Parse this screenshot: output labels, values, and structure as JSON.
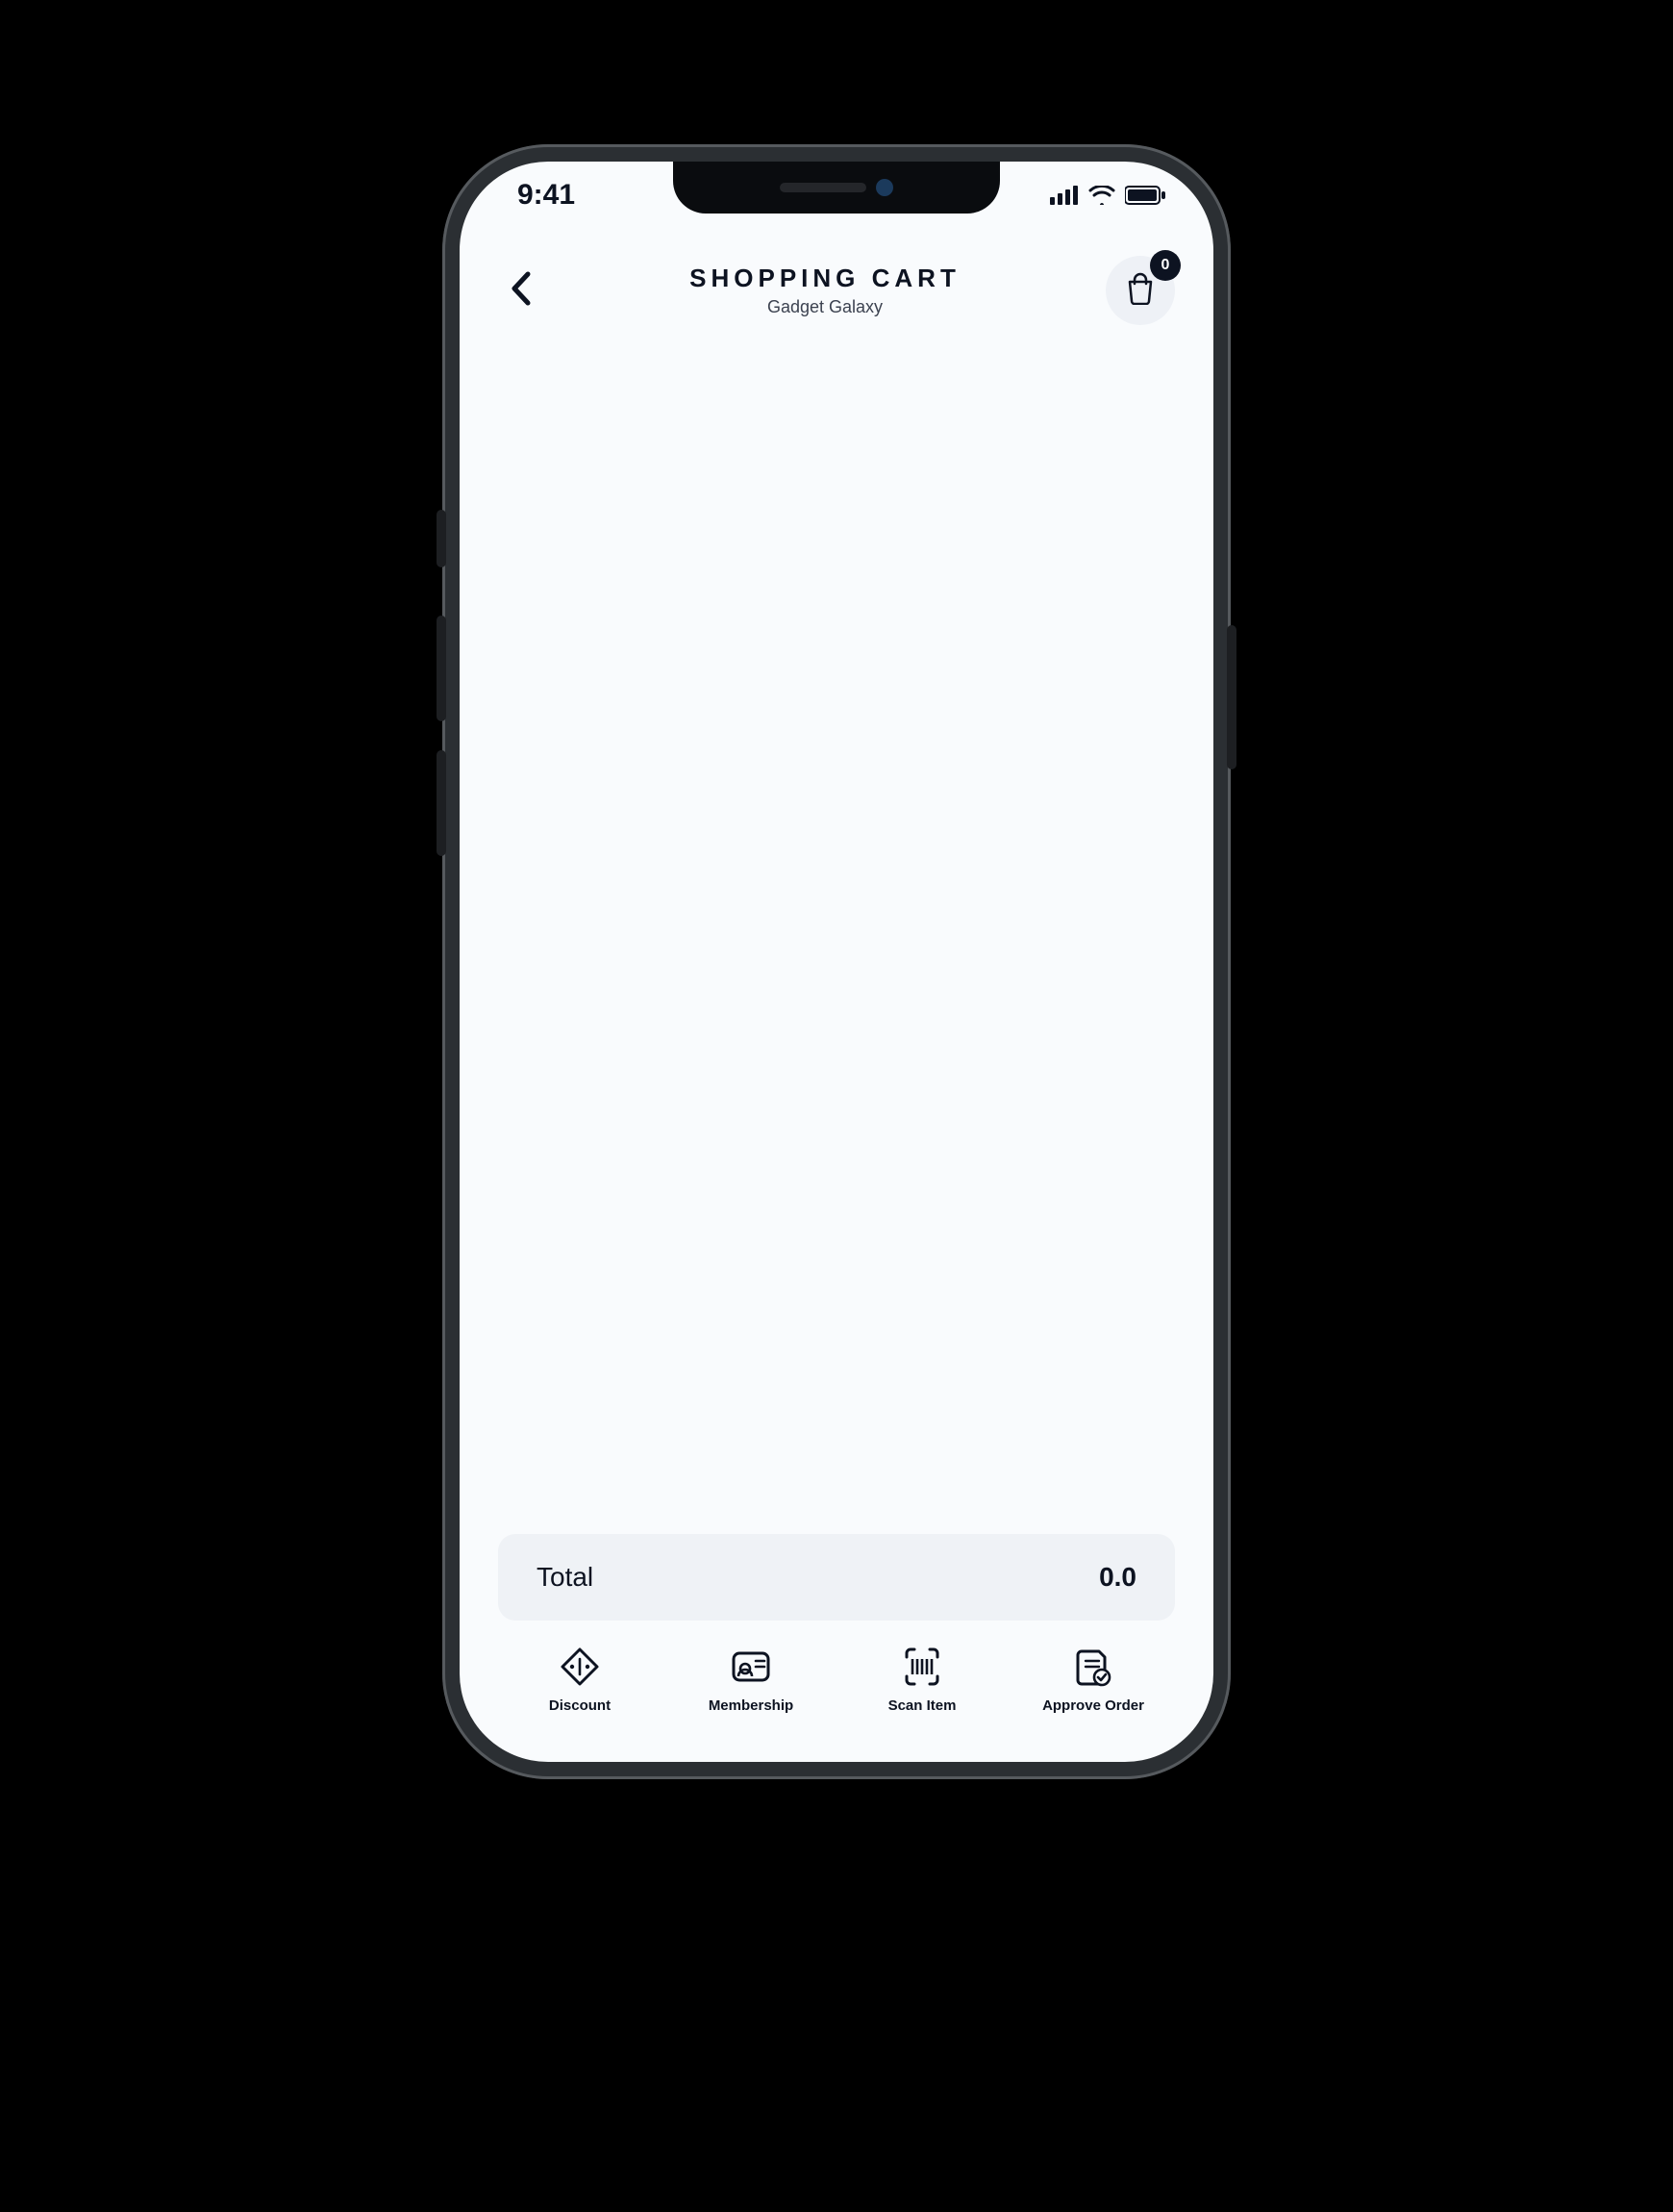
{
  "status_bar": {
    "time": "9:41"
  },
  "header": {
    "title": "SHOPPING CART",
    "subtitle": "Gadget Galaxy",
    "cart_badge": "0"
  },
  "total": {
    "label": "Total",
    "value": "0.0"
  },
  "actions": [
    {
      "label": "Discount"
    },
    {
      "label": "Membership"
    },
    {
      "label": "Scan Item"
    },
    {
      "label": "Approve Order"
    }
  ],
  "colors": {
    "background": "#f9fbfd",
    "panel": "#eff2f6",
    "text": "#0d1321",
    "badge_bg": "#0d1321",
    "badge_text": "#ffffff"
  }
}
